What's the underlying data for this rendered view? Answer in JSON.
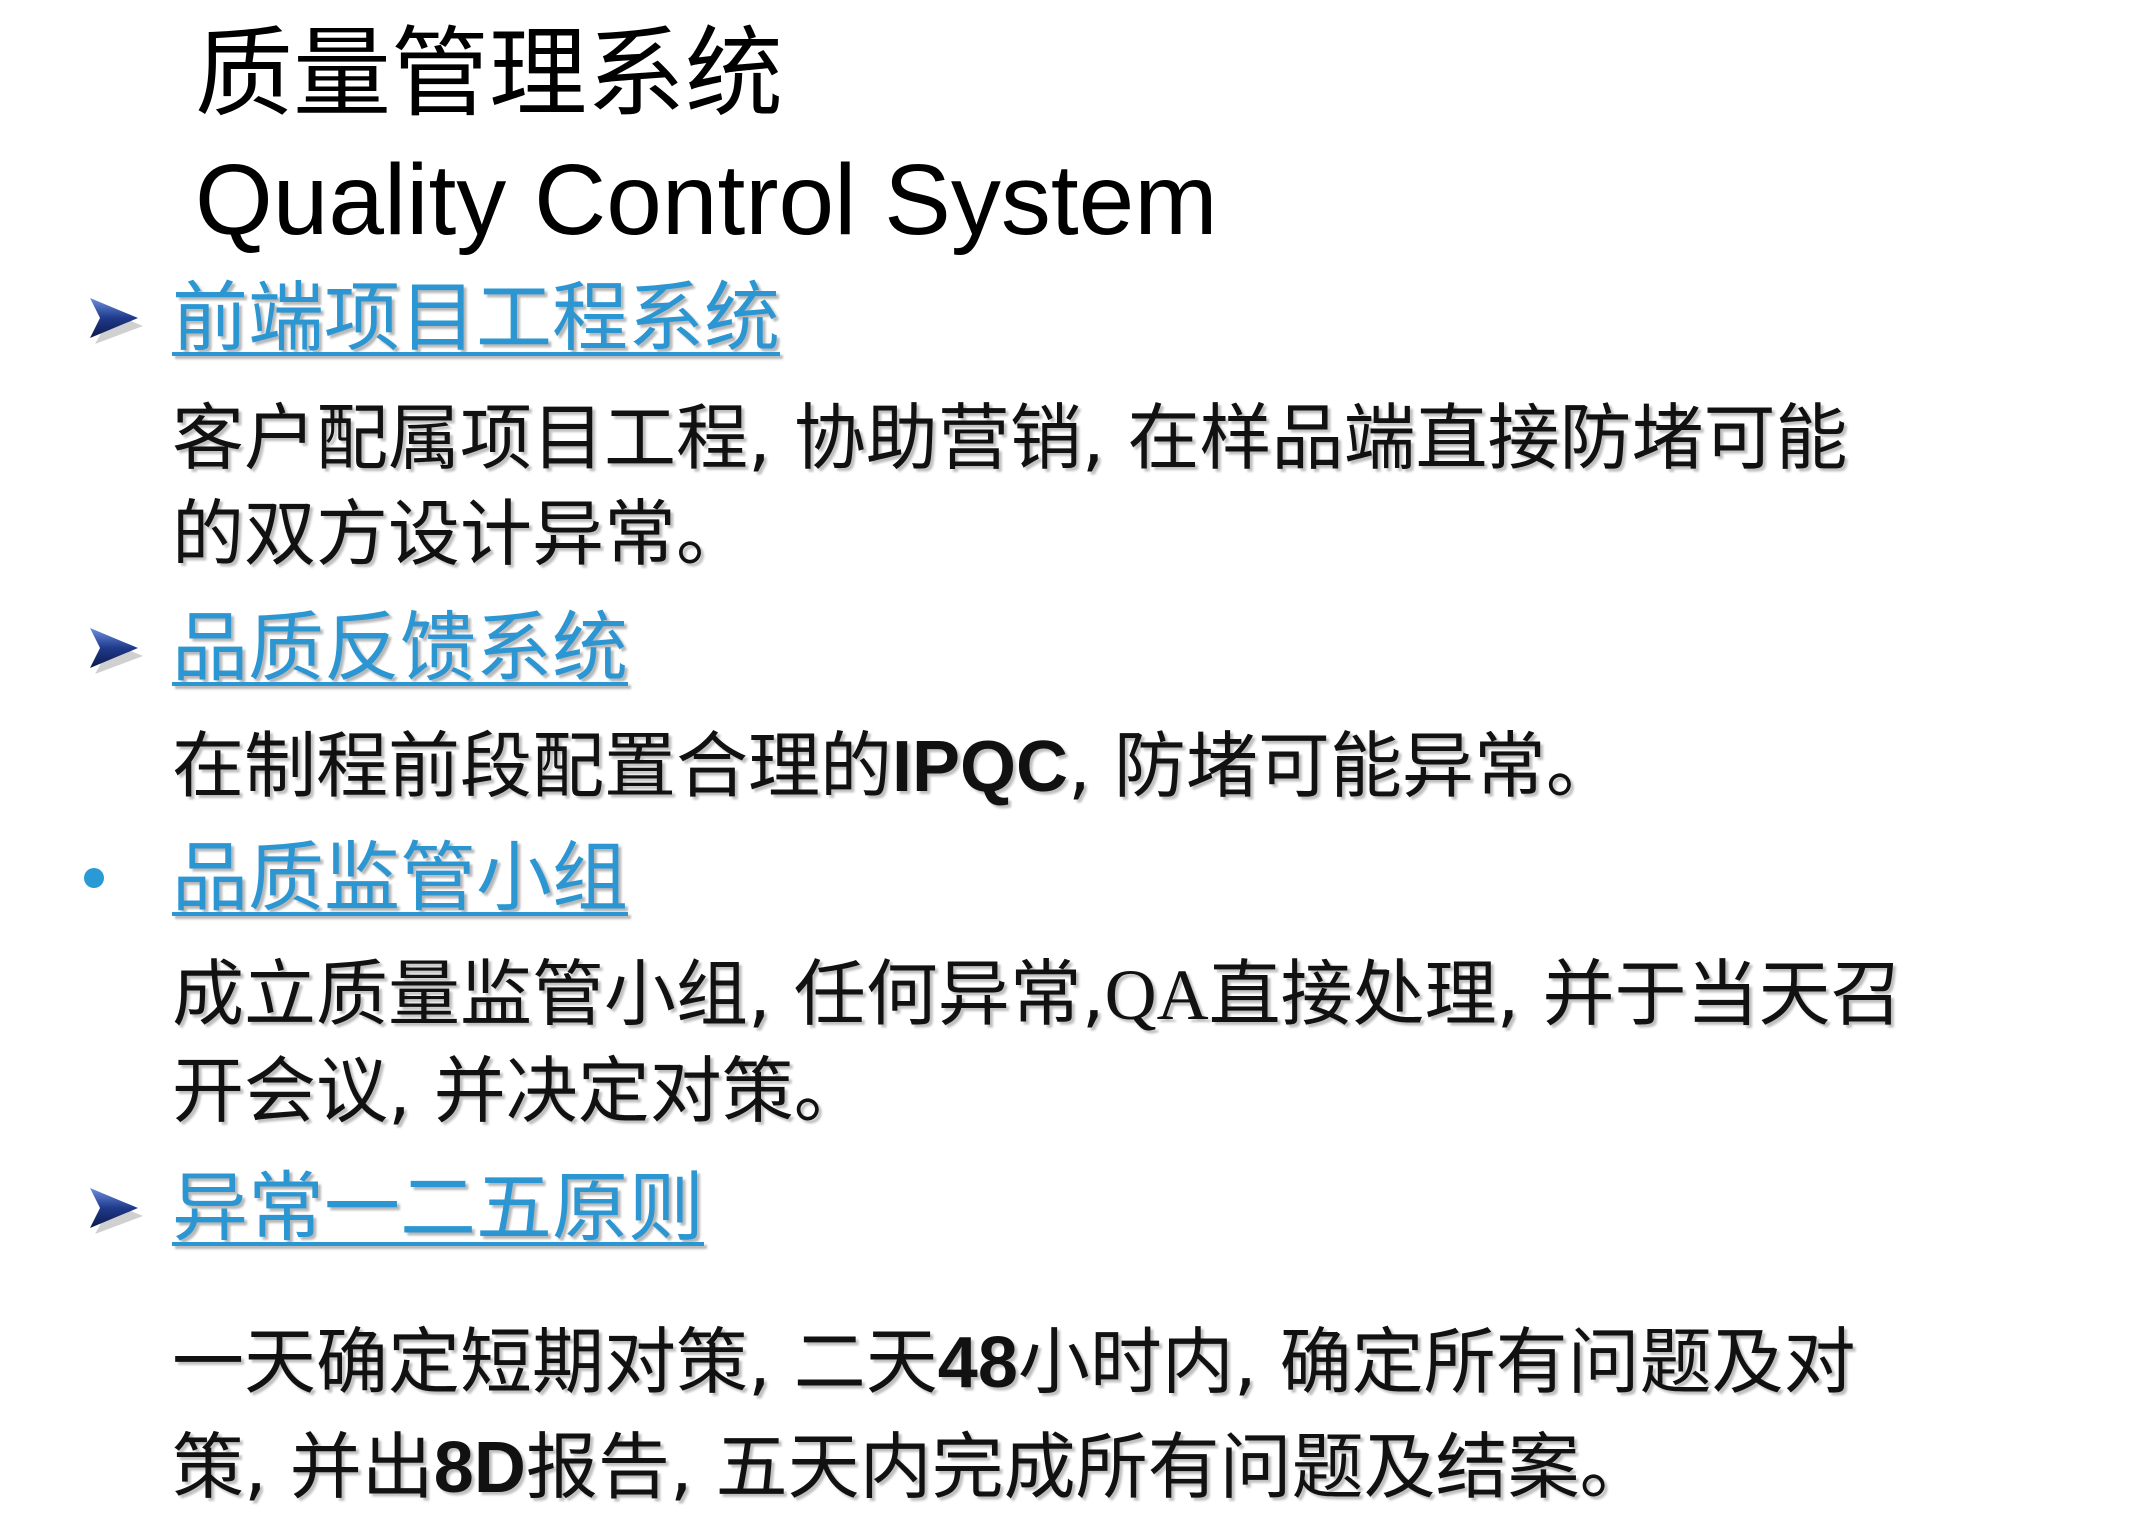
{
  "title": {
    "chinese": "质量管理系统",
    "english": "Quality Control System"
  },
  "colors": {
    "heading": "#2b96d2",
    "bullet_arrow": "#1f3a8a",
    "bullet_dot": "#2a9ad6"
  },
  "sections": [
    {
      "bullet": "arrow-icon",
      "heading": "前端项目工程系统",
      "lines": [
        "客户配属项目工程, 协助营销, 在样品端直接防堵可能",
        "的双方设计异常。"
      ]
    },
    {
      "bullet": "arrow-icon",
      "heading": "品质反馈系统",
      "line_parts": [
        "在制程前段配置合理的",
        "IPQC",
        ", 防堵可能异常。"
      ]
    },
    {
      "bullet": "dot-icon",
      "heading": "品质监管小组",
      "line1_parts": [
        "成立质量监管小组, 任何异常,",
        "QA",
        "直接处理, 并于当天召"
      ],
      "line2": "开会议, 并决定对策。"
    },
    {
      "bullet": "arrow-icon",
      "heading": "异常一二五原则",
      "line1_parts": [
        "一天确定短期对策, 二天",
        "48",
        "小时内, 确定所有问题及对"
      ],
      "line2_parts": [
        "策, 并出",
        "8D",
        "报告, 五天内完成所有问题及结案。"
      ]
    }
  ]
}
